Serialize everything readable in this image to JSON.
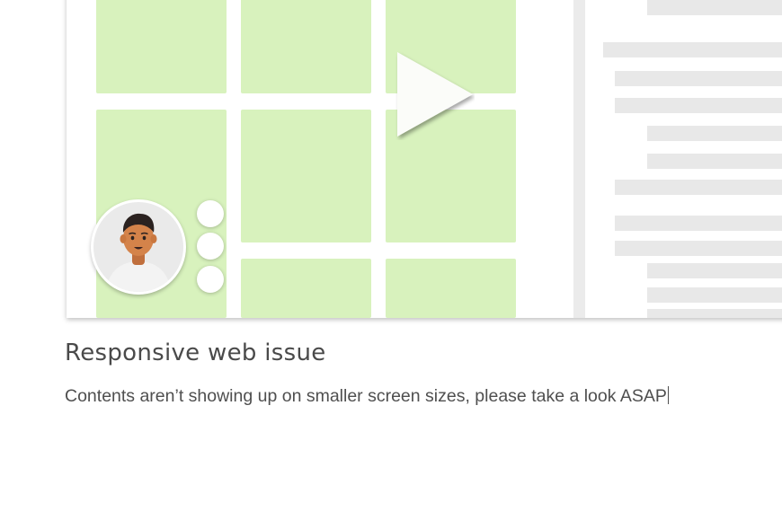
{
  "card": {
    "title": "Responsive web issue",
    "description": "Contents aren’t showing up on smaller screen sizes, please take a look ASAP"
  },
  "preview": {
    "tile_color": "#d8f2bd",
    "line_color": "#e8e8e8",
    "icons": [
      "play-icon",
      "avatar-icon",
      "more-options-icon"
    ]
  }
}
